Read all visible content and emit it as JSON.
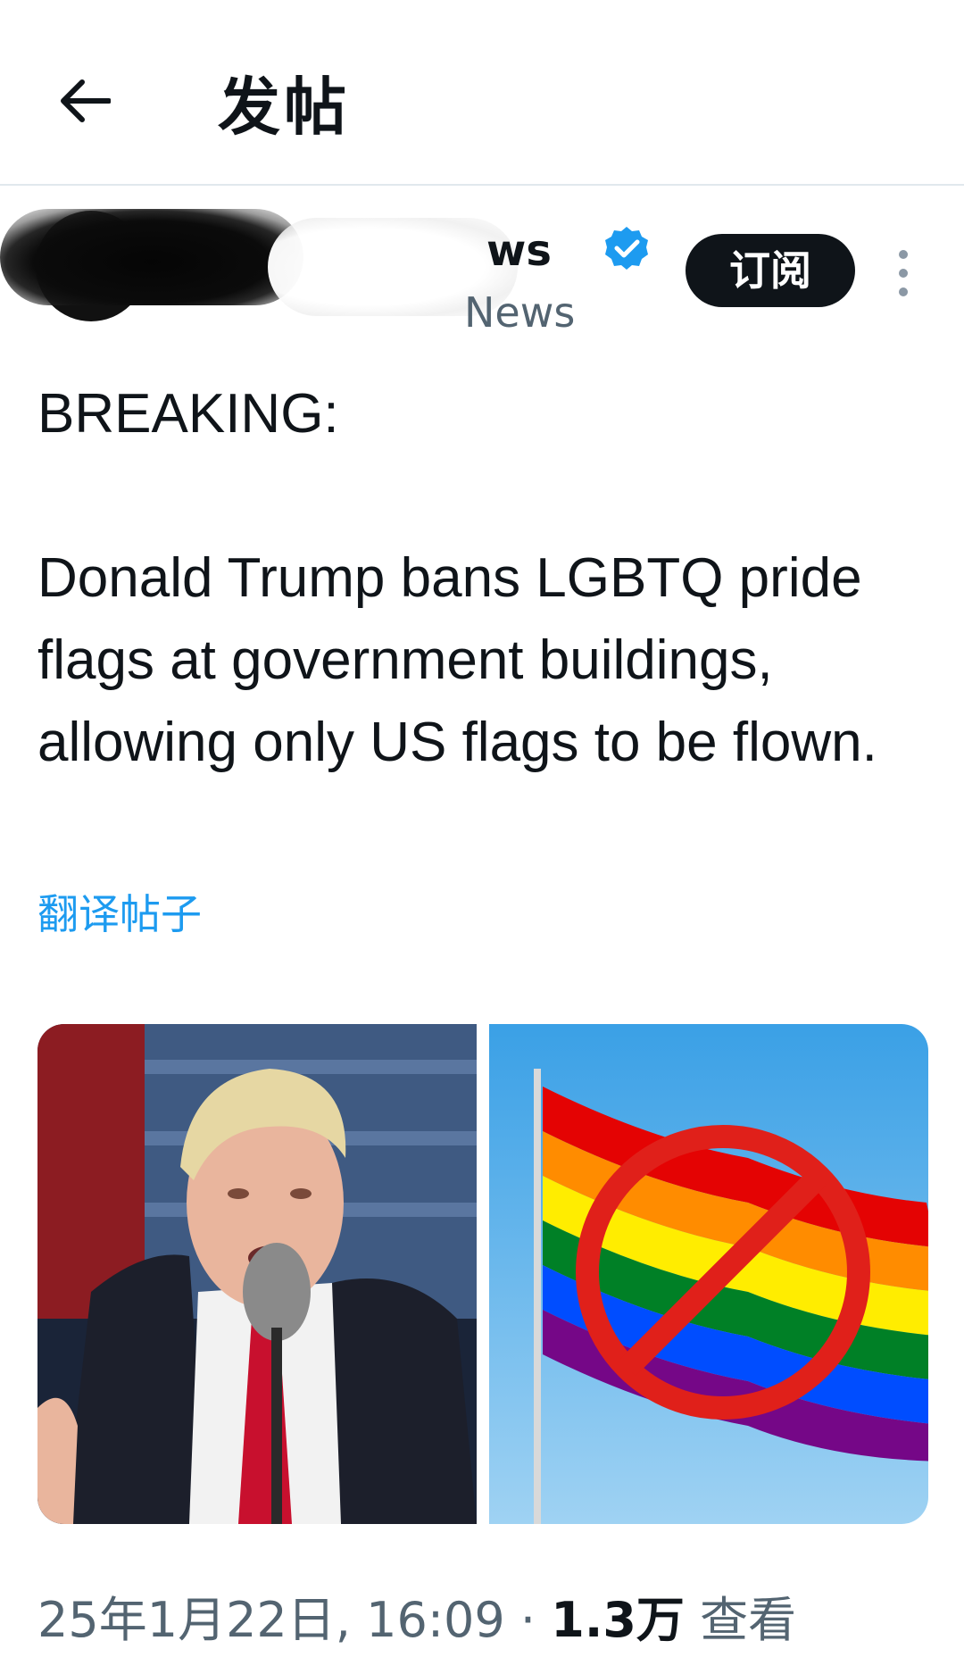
{
  "header": {
    "title": "发帖",
    "back_icon": "arrow-left-icon"
  },
  "author": {
    "display_name_visible": "ws",
    "handle_visible": "News",
    "verified_icon": "verified-badge-icon",
    "verified_color": "#1d9bf0",
    "subscribe_label": "订阅",
    "more_icon": "more-vertical-icon"
  },
  "post": {
    "line_1": "BREAKING:",
    "line_2": "Donald Trump bans LGBTQ pride flags at government buildings, allowing only US flags to be flown.",
    "translate_label": "翻译帖子"
  },
  "media": [
    {
      "name": "photo-speaker-at-microphone"
    },
    {
      "name": "photo-rainbow-flag-prohibited"
    }
  ],
  "meta": {
    "datetime": "25年1月22日, 16:09",
    "separator": "·",
    "views_count": "1.3万",
    "views_label": "查看"
  },
  "colors": {
    "accent": "#1d9bf0",
    "text_primary": "#0f1419",
    "text_secondary": "#536471",
    "prohibit_red": "#e0201a"
  }
}
